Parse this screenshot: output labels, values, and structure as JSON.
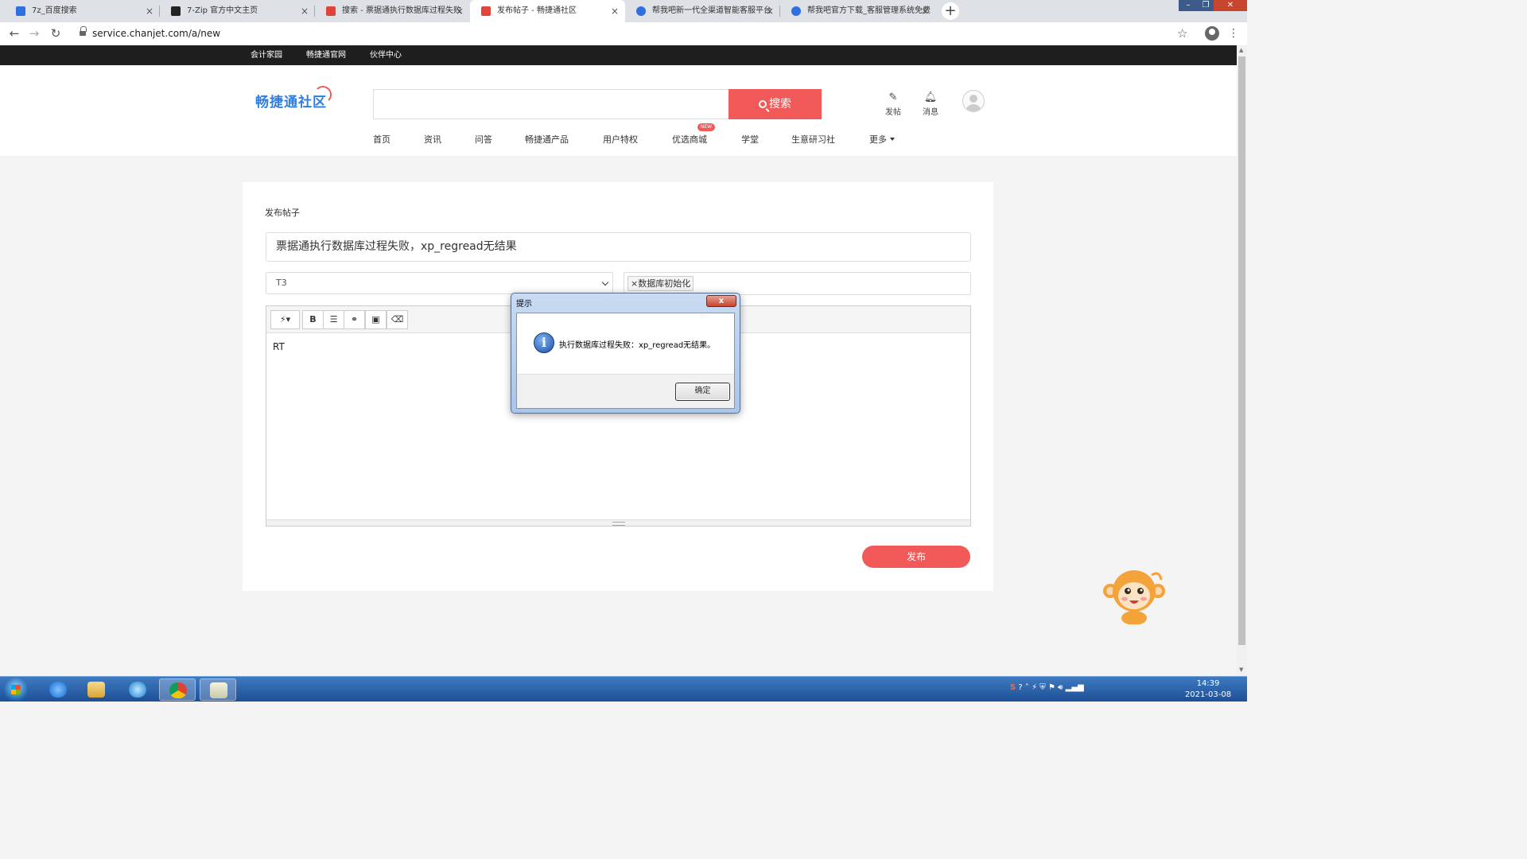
{
  "browser": {
    "tabs": [
      {
        "label": "7z_百度搜索",
        "color": "#2f6fe0"
      },
      {
        "label": "7-Zip 官方中文主页",
        "color": "#222222"
      },
      {
        "label": "搜索 - 票据通执行数据库过程失败",
        "color": "#e0443a"
      },
      {
        "label": "发布帖子 - 畅捷通社区",
        "color": "#e0443a"
      },
      {
        "label": "帮我吧新一代全渠道智能客服平台",
        "color": "#2f6fe0"
      },
      {
        "label": "帮我吧官方下载_客服管理系统免费",
        "color": "#2f6fe0"
      }
    ],
    "url": "service.chanjet.com/a/new"
  },
  "topbar": {
    "links": [
      "会计家园",
      "畅捷通官网",
      "伙伴中心"
    ]
  },
  "header": {
    "logo_text": "畅捷通社区",
    "search_placeholder": "",
    "search_button": "搜索",
    "post_label": "发帖",
    "message_label": "消息",
    "nav": [
      "首页",
      "资讯",
      "问答",
      "畅捷通产品",
      "用户特权",
      "优选商城",
      "学堂",
      "生意研习社",
      "更多"
    ],
    "new_badge": "NEW"
  },
  "form": {
    "page_title": "发布帖子",
    "title_value": "票据通执行数据库过程失败，xp_regread无结果",
    "product_selected": "T3",
    "tags": [
      "数据库初始化"
    ],
    "tag_remove": "×",
    "toolbar": [
      "magic-icon",
      "bold-icon",
      "list-icon",
      "link-icon",
      "image-icon",
      "eraser-icon"
    ],
    "body_text": "RT",
    "publish_button": "发布"
  },
  "dialog": {
    "title": "提示",
    "message": "执行数据库过程失败：xp_regread无结果。",
    "ok_button": "确定",
    "close_glyph": "x"
  },
  "taskbar": {
    "time": "14:39",
    "date": "2021-03-08"
  },
  "colors": {
    "accent": "#f25a5a",
    "brand_blue": "#2f7ee0"
  }
}
